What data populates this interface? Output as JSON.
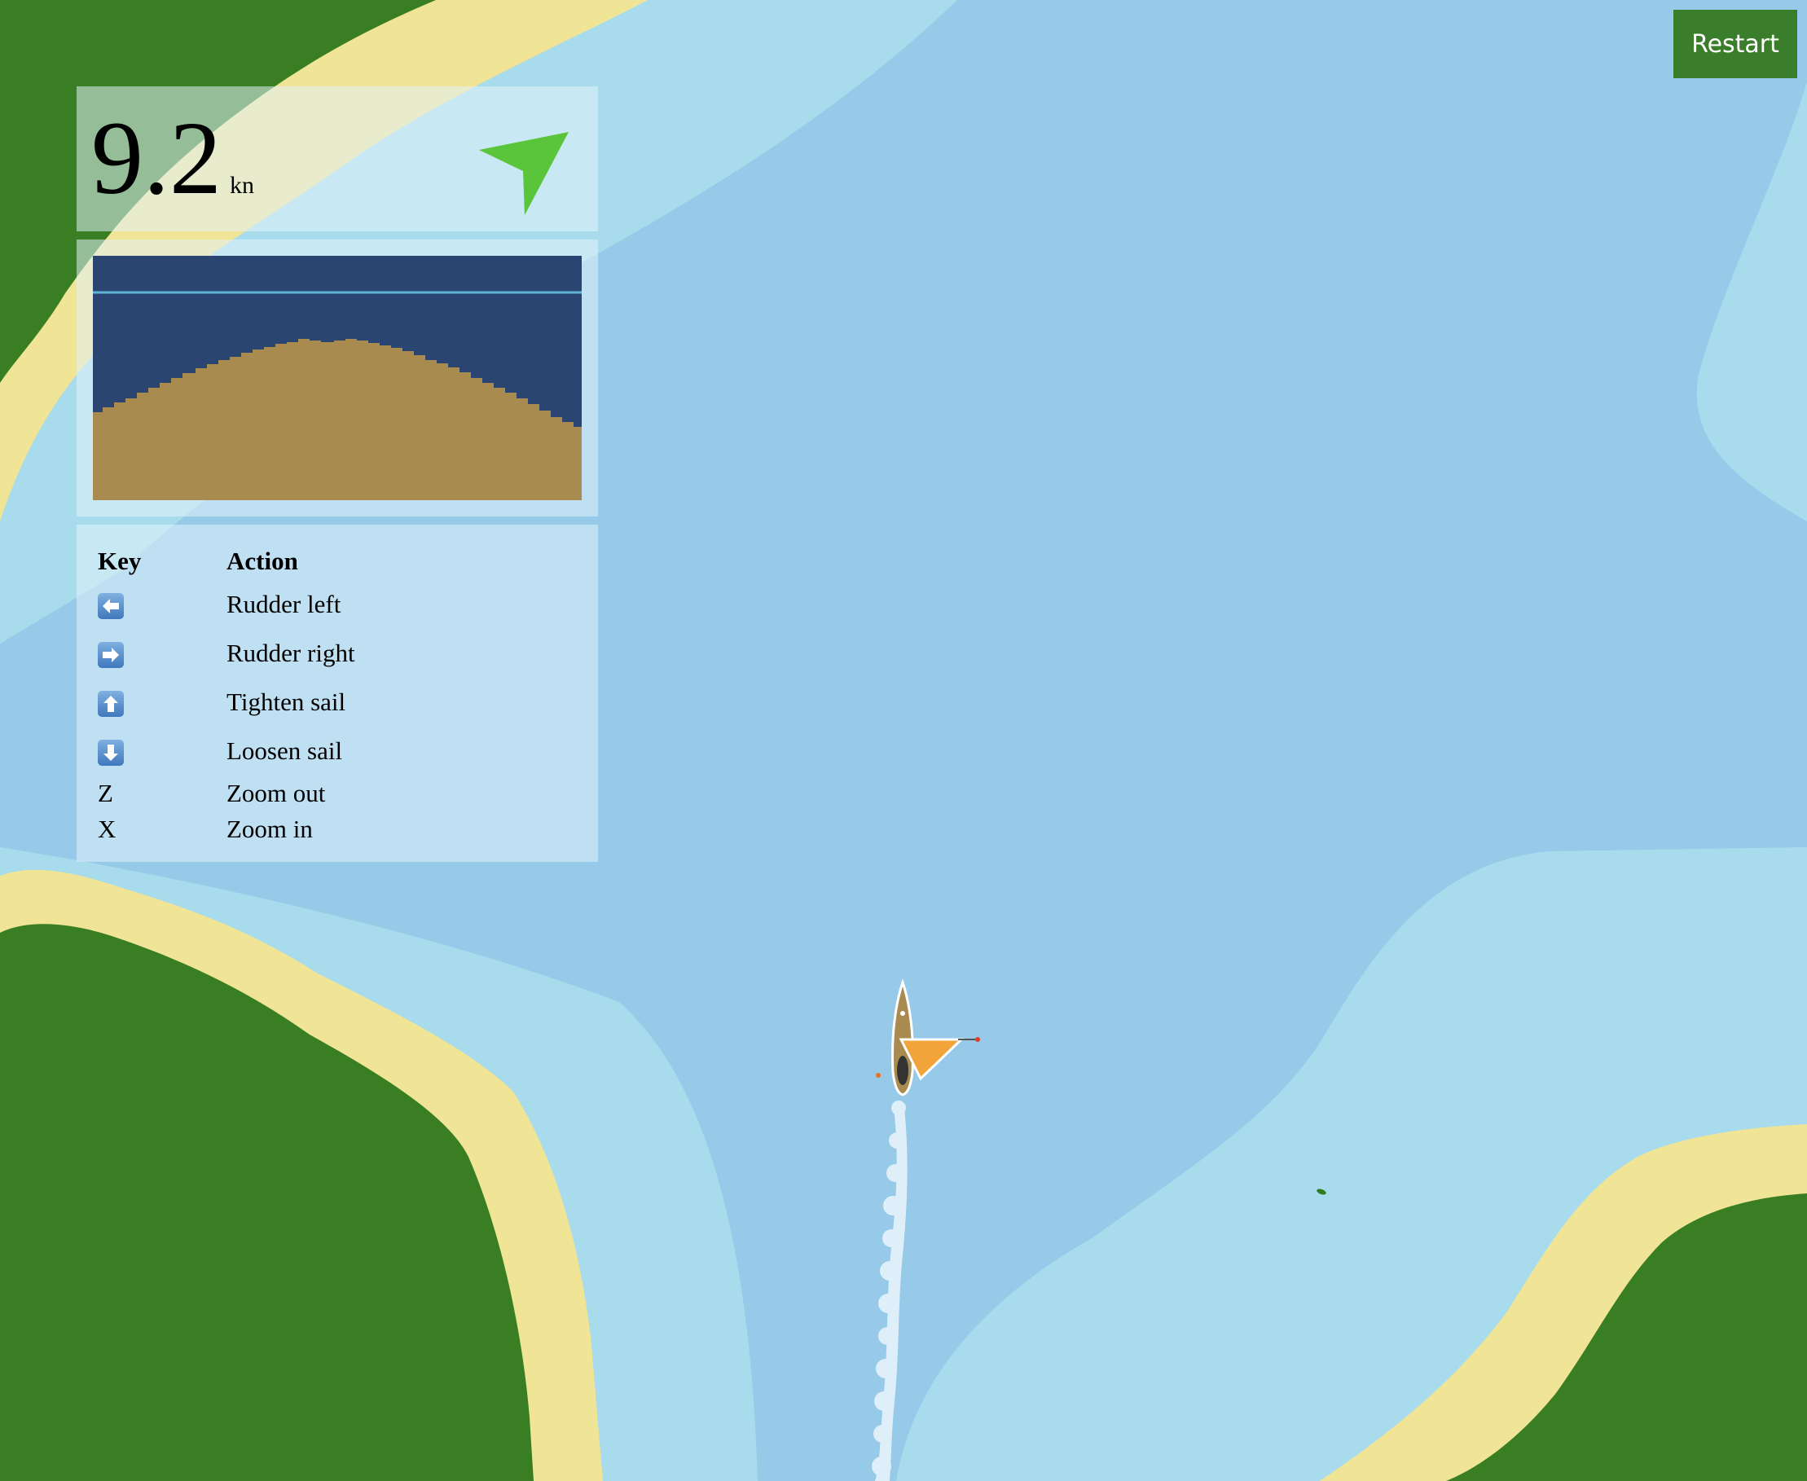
{
  "restart_button": {
    "label": "Restart"
  },
  "speed": {
    "value": "9.2",
    "unit": "kn"
  },
  "wind_indicator": {
    "icon": "wind-direction-arrow-icon",
    "color": "#5ac43a"
  },
  "depth_sounder": {
    "water_color": "#2a4572",
    "seabed_color": "#a98b50",
    "surface_line_color": "#5fb4d8"
  },
  "controls": {
    "headers": {
      "key": "Key",
      "action": "Action"
    },
    "rows": [
      {
        "key_icon": "left-arrow-key-icon",
        "action": "Rudder left"
      },
      {
        "key_icon": "right-arrow-key-icon",
        "action": "Rudder right"
      },
      {
        "key_icon": "up-arrow-key-icon",
        "action": "Tighten sail"
      },
      {
        "key_icon": "down-arrow-key-icon",
        "action": "Loosen sail"
      },
      {
        "key": "Z",
        "action": "Zoom out"
      },
      {
        "key": "X",
        "action": "Zoom in"
      }
    ]
  },
  "map_colors": {
    "deep_water": "#96cae8",
    "shallow_water": "#a8dbec",
    "sand": "#f0e497",
    "land": "#397e22",
    "sail": "#f2a33a"
  }
}
